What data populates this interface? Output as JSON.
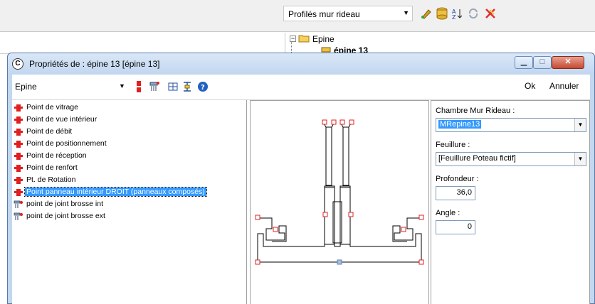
{
  "app": {
    "profile_combo": "Profilés mur rideau",
    "tree": {
      "root": "Epine",
      "child": "épine 13"
    }
  },
  "dialog": {
    "title": "Propriétés de : épine 13 [épine 13]",
    "toolbar": {
      "type_combo": "Epine",
      "ok_label": "Ok",
      "cancel_label": "Annuler"
    },
    "points": [
      {
        "label": "Point de vitrage",
        "icon": "red-point-icon"
      },
      {
        "label": "Point de vue intérieur",
        "icon": "red-point-icon"
      },
      {
        "label": "Point de débit",
        "icon": "red-point-icon"
      },
      {
        "label": "Point de positionnement",
        "icon": "red-point-icon"
      },
      {
        "label": "Point de réception",
        "icon": "red-point-icon"
      },
      {
        "label": "Point de renfort",
        "icon": "red-point-icon"
      },
      {
        "label": "Pt. de Rotation",
        "icon": "red-point-icon"
      },
      {
        "label": "Point panneau intérieur DROIT (panneaux composés)",
        "icon": "red-point-icon",
        "selected": true
      },
      {
        "label": "point de joint brosse int",
        "icon": "brush-joint-icon"
      },
      {
        "label": "point de joint brosse ext",
        "icon": "brush-joint-icon"
      }
    ],
    "properties": {
      "chambre_label": "Chambre Mur Rideau :",
      "chambre_value": "MRepine13",
      "feuillure_label": "Feuillure :",
      "feuillure_value": "[Feuillure Poteau fictif]",
      "profondeur_label": "Profondeur :",
      "profondeur_value": "36,0",
      "angle_label": "Angle :",
      "angle_value": "0"
    }
  },
  "colors": {
    "selection": "#3399ff",
    "point_marker": "#e02020",
    "dialog_frame": "#c3d7ee"
  }
}
